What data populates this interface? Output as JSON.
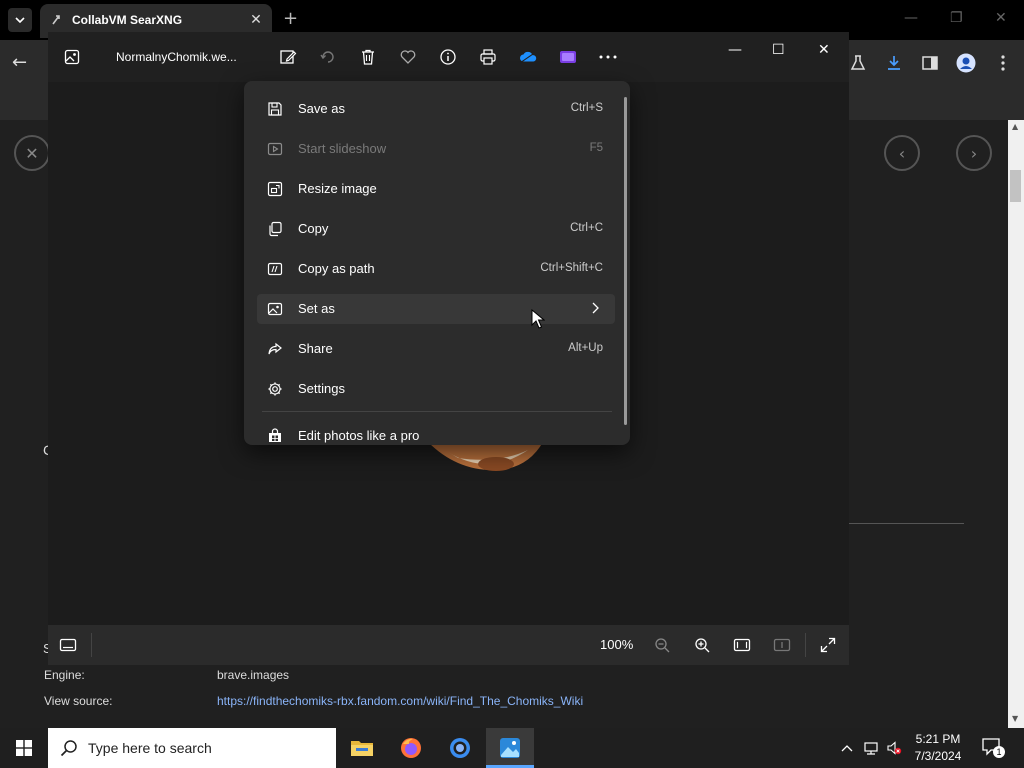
{
  "browser": {
    "tab_title": "CollabVM SearXNG",
    "tab_close": "✕",
    "new_tab": "+",
    "back": "←"
  },
  "page": {
    "close_glyph": "✕",
    "prev_glyph": "‹",
    "next_glyph": "›",
    "engine_label": "Engine:",
    "engine_value": "brave.images",
    "source_label": "View source:",
    "source_link": "https://findthechomiks-rbx.fandom.com/wiki/Find_The_Chomiks_Wiki",
    "partial_letter_1": "C",
    "partial_letter_2": "S"
  },
  "photos": {
    "file_name": "NormalnyChomik.we...",
    "zoom_level": "100%",
    "menu_items": [
      {
        "label": "Save as",
        "shortcut": "Ctrl+S",
        "icon": "save-icon",
        "disabled": false
      },
      {
        "label": "Start slideshow",
        "shortcut": "F5",
        "icon": "slideshow-icon",
        "disabled": true
      },
      {
        "label": "Resize image",
        "shortcut": "",
        "icon": "resize-icon",
        "disabled": false
      },
      {
        "label": "Copy",
        "shortcut": "Ctrl+C",
        "icon": "copy-icon",
        "disabled": false
      },
      {
        "label": "Copy as path",
        "shortcut": "Ctrl+Shift+C",
        "icon": "copy-path-icon",
        "disabled": false
      },
      {
        "label": "Set as",
        "shortcut": "",
        "icon": "set-as-icon",
        "disabled": false,
        "submenu": true
      },
      {
        "label": "Share",
        "shortcut": "Alt+Up",
        "icon": "share-icon",
        "disabled": false
      },
      {
        "label": "Settings",
        "shortcut": "",
        "icon": "settings-icon",
        "disabled": false
      }
    ],
    "promo_label": "Edit photos like a pro"
  },
  "taskbar": {
    "search_placeholder": "Type here to search",
    "time": "5:21 PM",
    "date": "7/3/2024",
    "notification_count": "1"
  },
  "colors": {
    "accent_blue": "#8ab4f8",
    "menu_bg": "#2c2c2c",
    "window_bg": "#202020"
  }
}
